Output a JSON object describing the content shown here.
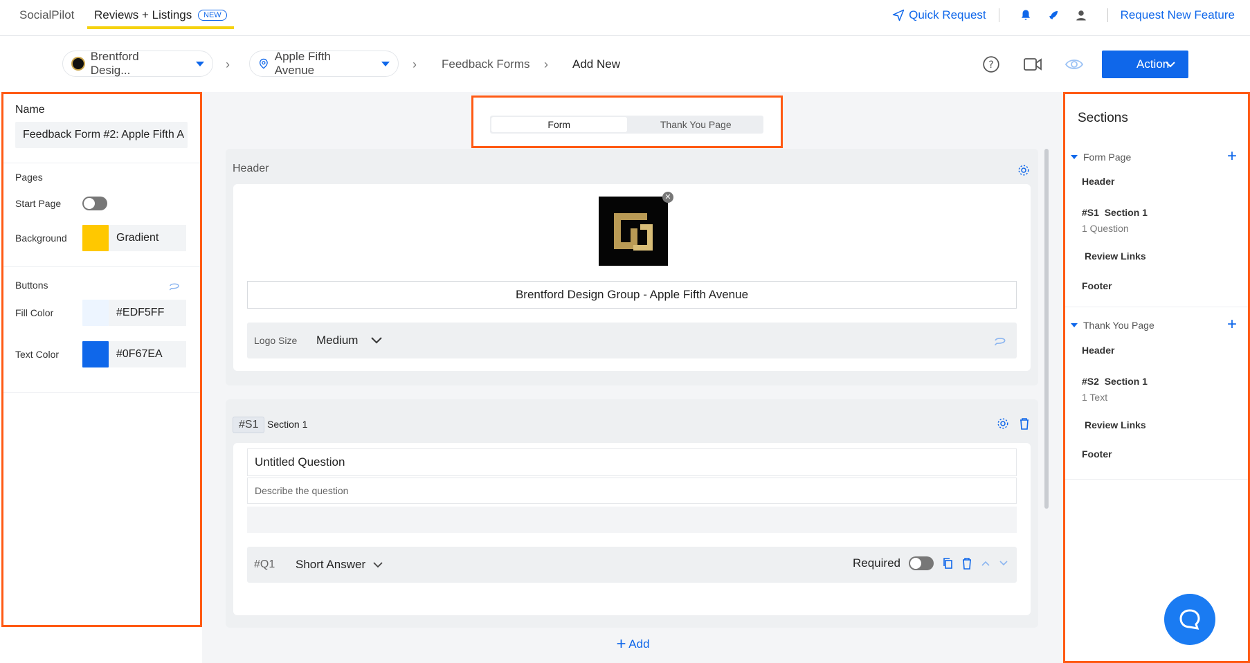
{
  "topnav": {
    "brand": "SocialPilot",
    "active_tab": "Reviews + Listings",
    "new_badge": "NEW",
    "quick_request": "Quick Request",
    "request_feature": "Request New Feature"
  },
  "breadcrumb": {
    "business": "Brentford Desig...",
    "location": "Apple Fifth Avenue",
    "forms": "Feedback Forms",
    "current": "Add New"
  },
  "action": {
    "label": "Action"
  },
  "left_panel": {
    "name_label": "Name",
    "name_value": "Feedback Form #2: Apple Fifth A",
    "pages_label": "Pages",
    "start_page_label": "Start Page",
    "background_label": "Background",
    "background_value": "Gradient",
    "background_color": "#FFC800",
    "buttons_label": "Buttons",
    "fill_color_label": "Fill Color",
    "fill_color_value": "#EDF5FF",
    "text_color_label": "Text Color",
    "text_color_value": "#0F67EA"
  },
  "tabs": {
    "form": "Form",
    "thank_you": "Thank You Page"
  },
  "header_card": {
    "title": "Header",
    "business_name": "Brentford Design Group - Apple Fifth Avenue",
    "logo_size_label": "Logo Size",
    "logo_size_value": "Medium"
  },
  "section_card": {
    "tag": "#S1",
    "title": "Section 1",
    "question_title": "Untitled Question",
    "question_desc": "Describe the question",
    "q_tag": "#Q1",
    "q_type": "Short Answer",
    "required_label": "Required"
  },
  "add_label": "Add",
  "right_panel": {
    "title": "Sections",
    "form_page": {
      "label": "Form Page",
      "header": "Header",
      "section_tag": "#S1",
      "section_title": "Section 1",
      "section_sub": "1 Question",
      "review_links": "Review Links",
      "footer": "Footer"
    },
    "thank_you_page": {
      "label": "Thank You Page",
      "header": "Header",
      "section_tag": "#S2",
      "section_title": "Section 1",
      "section_sub": "1 Text",
      "review_links": "Review Links",
      "footer": "Footer"
    }
  },
  "colors": {
    "accent": "#0F67EA",
    "highlight": "#FF5A14",
    "tab_underline": "#F5D20F"
  }
}
